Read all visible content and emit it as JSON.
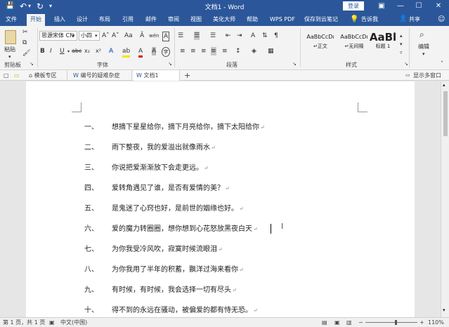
{
  "window": {
    "title": "文档1 - Word",
    "login_label": "登录",
    "minimize": "—",
    "maximize": "☐",
    "close": "✕",
    "ribbon_toggle": "▣"
  },
  "quick_access": {
    "save": "💾",
    "undo": "↶",
    "undo_more": "▾",
    "redo": "↻",
    "customize": "▾"
  },
  "tabs": [
    "文件",
    "开始",
    "插入",
    "设计",
    "布局",
    "引用",
    "邮件",
    "审阅",
    "视图",
    "美化大师",
    "帮助",
    "WPS PDF",
    "保存到云笔记"
  ],
  "active_tab_index": 1,
  "tell_me": "告诉我",
  "share": "共享",
  "ribbon": {
    "clipboard": {
      "paste": "粘贴",
      "label": "剪贴板"
    },
    "font": {
      "name": "思源宋体 CN",
      "size": "小四",
      "label": "字体",
      "bold": "B",
      "italic": "I",
      "underline": "U",
      "strike": "abc",
      "subscript": "x₂",
      "superscript": "x²",
      "grow": "A˄",
      "shrink": "A˅",
      "change_case": "Aa",
      "clear_format": "Ã",
      "pinyin": "wén",
      "char_border": "A",
      "effects": "A",
      "highlight": "ab",
      "font_color": "A",
      "char_shading": "A",
      "enclose": "字"
    },
    "paragraph": {
      "label": "段落"
    },
    "styles": {
      "label": "样式",
      "items": [
        {
          "preview": "AaBbCcDı",
          "name": "↵正文"
        },
        {
          "preview": "AaBbCcDı",
          "name": "↵无间隔"
        },
        {
          "preview": "AaBl",
          "name": "标题 1"
        }
      ]
    },
    "editing": {
      "label": "编辑"
    }
  },
  "file_tabs": [
    {
      "label": "模板专区"
    },
    {
      "label": "编号的疑难杂症"
    },
    {
      "label": "文档1"
    }
  ],
  "new_tab": "+",
  "multi_window": "显示多窗口",
  "document": {
    "lines": [
      {
        "num": "一、",
        "text": "想摘下星星给你，摘下月亮给你，摘下太阳给你"
      },
      {
        "num": "二、",
        "text": "雨下整夜，我的爱溢出就像雨水"
      },
      {
        "num": "三、",
        "text": "你说把爱渐渐放下会走更远。"
      },
      {
        "num": "四、",
        "text": "爱转角遇见了谁，是否有爱情的美？"
      },
      {
        "num": "五、",
        "text": "是鬼迷了心窍也好，是前世的姻缘也好。"
      },
      {
        "num": "六、",
        "text": "爱的魔力转圈圈，想你想到心花怒放黑夜白天"
      },
      {
        "num": "七、",
        "text": "为你我受冷风吹，寂寞时候流眼泪"
      },
      {
        "num": "八、",
        "text": "为你我用了半年的积蓄，飘洋过海来看你"
      },
      {
        "num": "九、",
        "text": "有时候，有时候，我会选择一切有尽头"
      },
      {
        "num": "十、",
        "text": "得不到的永远在骚动，被偏爱的都有恃无恐。"
      }
    ],
    "paragraph_mark": "↵"
  },
  "status": {
    "page": "第 1 页，共 1 页",
    "language": "中文(中国)",
    "zoom": "110%",
    "zoom_minus": "−",
    "zoom_plus": "+"
  }
}
